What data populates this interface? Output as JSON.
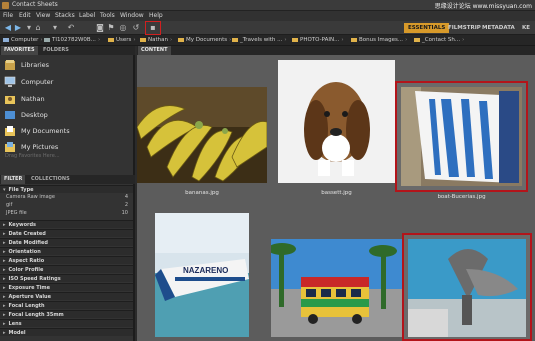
{
  "window": {
    "title": "Contact Sheets",
    "watermark": "思缘设计论坛  www.missyuan.com"
  },
  "menu": [
    "File",
    "Edit",
    "View",
    "Stacks",
    "Label",
    "Tools",
    "Window",
    "Help"
  ],
  "workspace": {
    "active": "ESSENTIALS",
    "others": [
      "FILMSTRIP",
      "METADATA",
      "KE"
    ]
  },
  "path": {
    "items": [
      "Computer",
      "TI102782W0B...",
      "Users",
      "Nathan",
      "My Documents",
      "_Travels with ...",
      "PHOTO-PAIN...",
      "Bonus Images...",
      "_Contact Sh..."
    ]
  },
  "left_tabs": {
    "favorites": "FAVORITES",
    "folders": "FOLDERS"
  },
  "favorites": [
    {
      "label": "Libraries",
      "icon": "libraries-icon"
    },
    {
      "label": "Computer",
      "icon": "computer-icon"
    },
    {
      "label": "Nathan",
      "icon": "user-folder-icon"
    },
    {
      "label": "Desktop",
      "icon": "desktop-icon"
    },
    {
      "label": "My Documents",
      "icon": "documents-icon"
    },
    {
      "label": "My Pictures",
      "icon": "pictures-icon"
    }
  ],
  "drag_hint": "Drag Favorites Here...",
  "filter_tabs": {
    "filter": "FILTER",
    "collections": "COLLECTIONS"
  },
  "filter": {
    "file_type": {
      "label": "File Type",
      "rows": [
        {
          "name": "Camera Raw image",
          "count": "4"
        },
        {
          "name": "gif",
          "count": "2"
        },
        {
          "name": "JPEG file",
          "count": "10"
        }
      ]
    },
    "sections": [
      "Keywords",
      "Date Created",
      "Date Modified",
      "Orientation",
      "Aspect Ratio",
      "Color Profile",
      "ISO Speed Ratings",
      "Exposure Time",
      "Aperture Value",
      "Focal Length",
      "Focal Length 35mm",
      "Lens",
      "Model"
    ]
  },
  "content": {
    "tab": "CONTENT"
  },
  "thumbnails": [
    {
      "name": "bananas.jpg",
      "selected": false
    },
    {
      "name": "bassett.jpg",
      "selected": false
    },
    {
      "name": "boat-Bucerias.jpg",
      "selected": true
    },
    {
      "name": "",
      "selected": false
    },
    {
      "name": "",
      "selected": false
    },
    {
      "name": "",
      "selected": false
    }
  ],
  "boat_text": "NAZARENO",
  "colors": {
    "accent": "#d89a2a",
    "selection": "#b3141a",
    "red_highlight": "#d02020"
  }
}
